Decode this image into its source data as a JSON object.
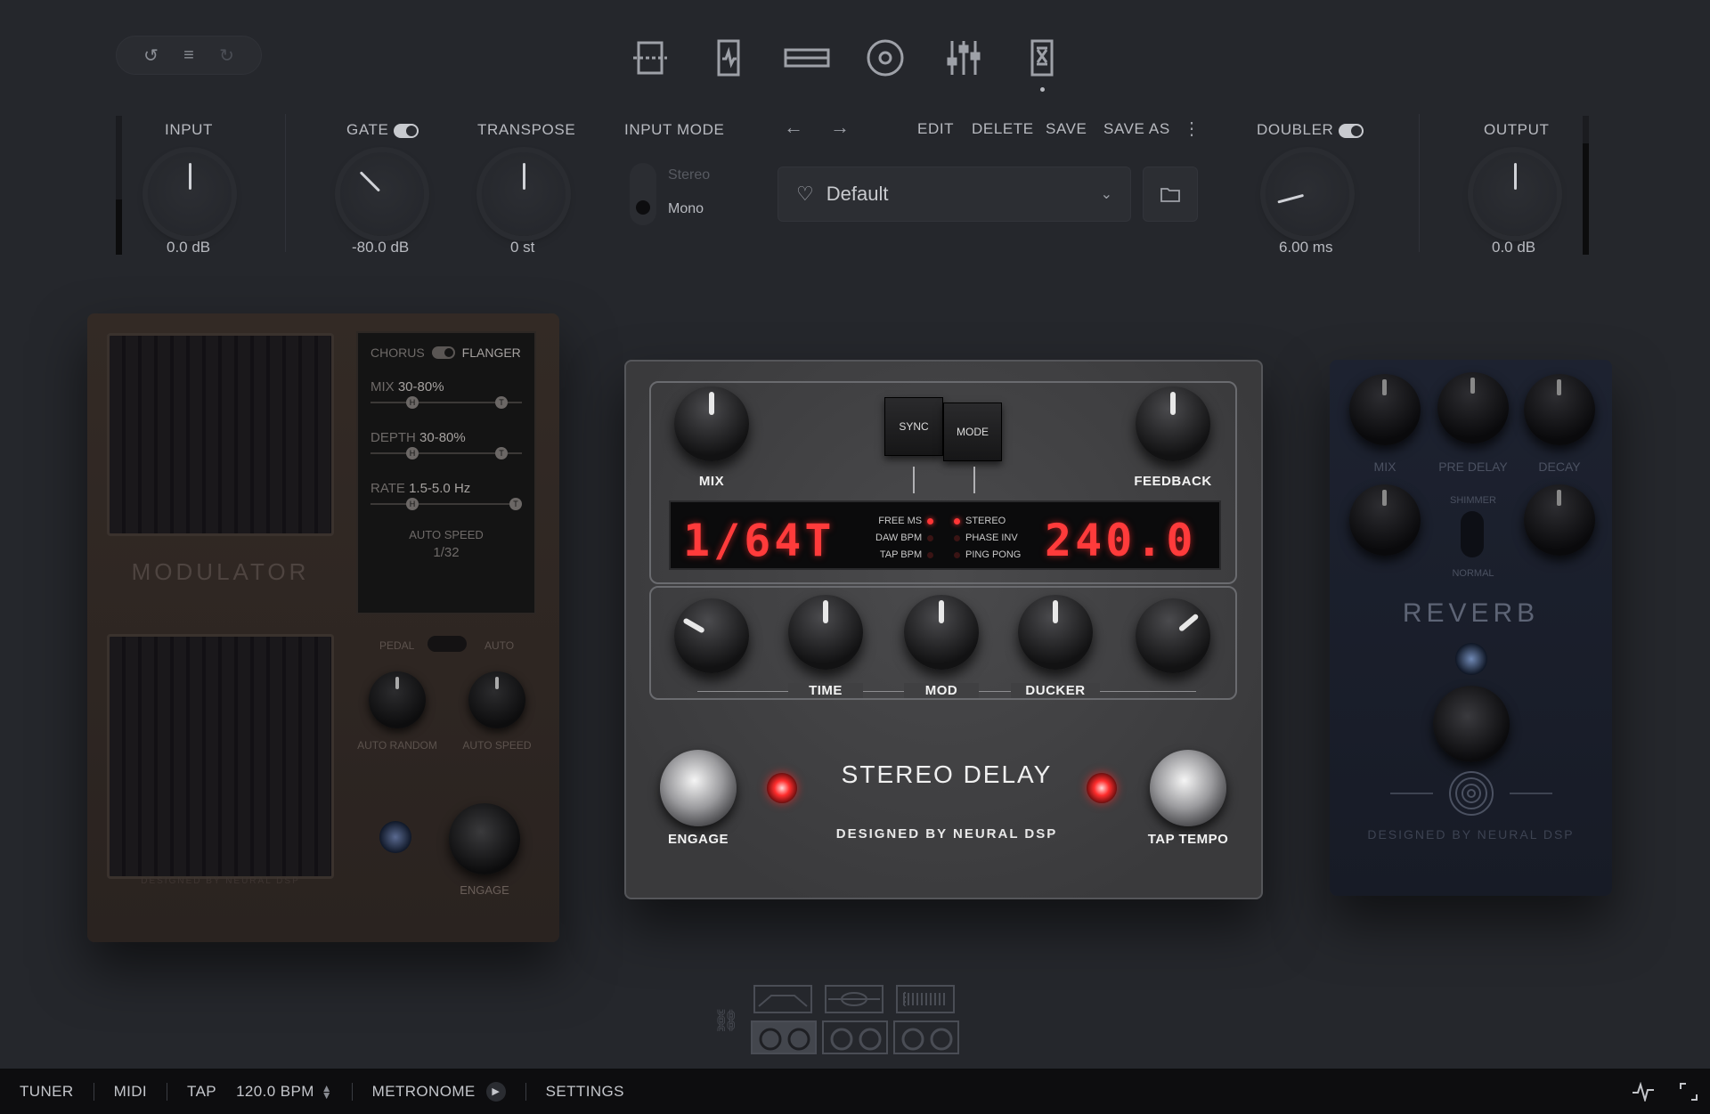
{
  "toolbar": {
    "undo_icon": "undo-icon",
    "menu_icon": "menu-icon",
    "redo_icon": "redo-icon",
    "view_icons": [
      "amp-view-icon",
      "cab-view-icon",
      "rack-view-icon",
      "circle-view-icon",
      "mixer-view-icon",
      "pedal-view-icon"
    ]
  },
  "controls": {
    "input": {
      "label": "INPUT",
      "value": "0.0 dB"
    },
    "gate": {
      "label": "GATE",
      "value": "-80.0 dB",
      "enabled": true
    },
    "transpose": {
      "label": "TRANSPOSE",
      "value": "0 st"
    },
    "input_mode": {
      "label": "INPUT MODE",
      "options": [
        "Stereo",
        "Mono"
      ],
      "selected": "Mono"
    },
    "doubler": {
      "label": "DOUBLER",
      "value": "6.00 ms",
      "enabled": true
    },
    "output": {
      "label": "OUTPUT",
      "value": "0.0 dB"
    }
  },
  "preset": {
    "back_arrow": "←",
    "forward_arrow": "→",
    "actions": {
      "edit": "EDIT",
      "delete": "DELETE",
      "save": "SAVE",
      "save_as": "SAVE AS",
      "more": "⋮"
    },
    "name": "Default"
  },
  "modulator": {
    "title": "MODULATOR",
    "mode_left": "CHORUS",
    "mode_right": "FLANGER",
    "params": [
      {
        "label": "MIX",
        "range": "30-80%"
      },
      {
        "label": "DEPTH",
        "range": "30-80%"
      },
      {
        "label": "RATE",
        "range": "1.5-5.0 Hz"
      }
    ],
    "auto_speed_label": "AUTO SPEED",
    "auto_speed_value": "1/32",
    "switch_left": "PEDAL",
    "switch_right": "AUTO",
    "knob1": "AUTO RANDOM",
    "knob2": "AUTO SPEED",
    "engage": "ENGAGE",
    "credit": "DESIGNED BY NEURAL DSP"
  },
  "delay": {
    "mix": "MIX",
    "feedback": "FEEDBACK",
    "sync": "SYNC",
    "mode": "MODE",
    "display_left": "1/64T",
    "display_right": "240.0",
    "time_modes": [
      "FREE MS",
      "DAW BPM",
      "TAP BPM"
    ],
    "stereo_modes": [
      "STEREO",
      "PHASE INV",
      "PING PONG"
    ],
    "knob_labels": [
      "TIME",
      "MOD",
      "DUCKER"
    ],
    "engage": "ENGAGE",
    "tap_tempo": "TAP TEMPO",
    "title": "STEREO DELAY",
    "credit": "DESIGNED BY NEURAL DSP"
  },
  "reverb": {
    "mix": "MIX",
    "pre_delay": "PRE DELAY",
    "decay": "DECAY",
    "shimmer": "SHIMMER",
    "normal": "NORMAL",
    "title": "REVERB",
    "credit": "DESIGNED BY NEURAL DSP"
  },
  "status_bar": {
    "tuner": "TUNER",
    "midi": "MIDI",
    "tap": "TAP",
    "bpm": "120.0 BPM",
    "metronome": "METRONOME",
    "settings": "SETTINGS"
  }
}
